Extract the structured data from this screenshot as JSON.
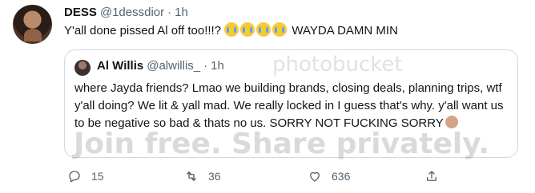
{
  "tweet": {
    "display_name": "DESS",
    "handle": "@1dessdior",
    "separator": "·",
    "time": "1h",
    "text_before": "Y'all done pissed Al off too!!!?",
    "text_after": "WAYDA DAMN MIN",
    "emojis": [
      "loudly-crying-face-emoji",
      "tears-of-joy-emoji",
      "tears-of-joy-emoji",
      "loudly-crying-face-emoji"
    ]
  },
  "quoted": {
    "display_name": "Al Willis",
    "handle": "@alwillis_",
    "separator": "·",
    "time": "1h",
    "text": "where Jayda friends? Lmao we building brands, closing deals, planning trips, wtf y'all doing? We lit & yall mad. We really locked in I guess that's why. y'all want us to be negative so bad & thats no us. SORRY NOT FUCKING SORRY",
    "trailing_emoji": "man-shrugging-emoji"
  },
  "watermark": {
    "top": "photobucket",
    "bottom": "Join free. Share privately."
  },
  "actions": {
    "replies": "15",
    "retweets": "36",
    "likes": "636"
  },
  "colors": {
    "text": "#0f1419",
    "secondary": "#536471",
    "border": "#cfd9de"
  }
}
